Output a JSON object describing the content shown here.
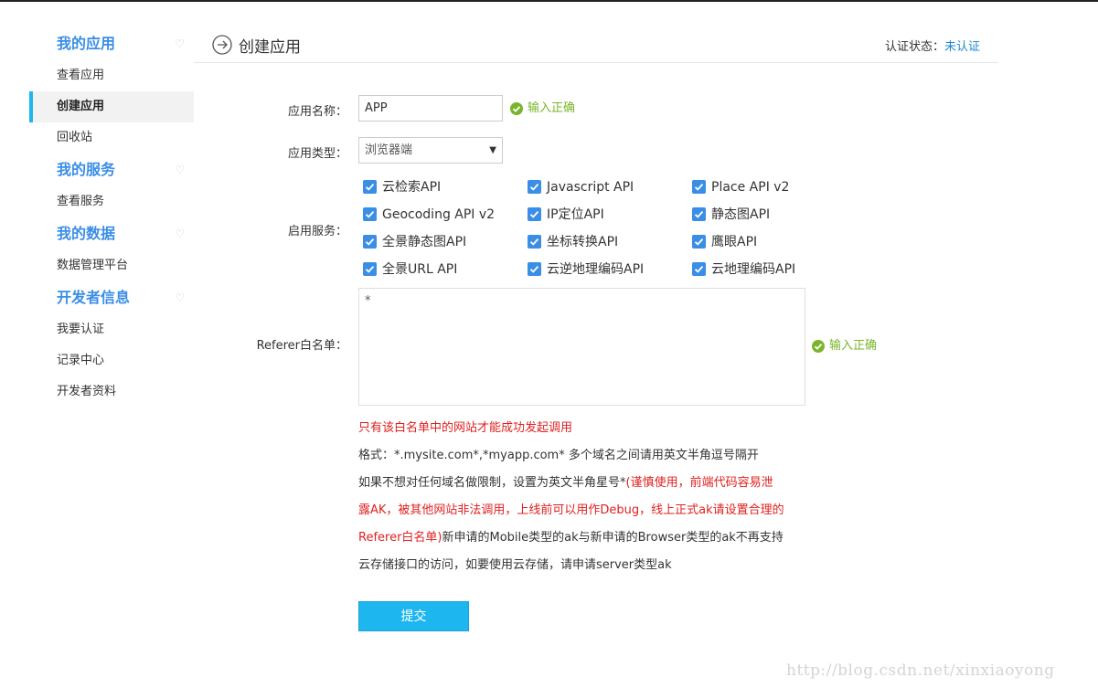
{
  "sidebar": {
    "groups": [
      {
        "title": "我的应用",
        "items": [
          "查看应用",
          "创建应用",
          "回收站"
        ]
      },
      {
        "title": "我的服务",
        "items": [
          "查看服务"
        ]
      },
      {
        "title": "我的数据",
        "items": [
          "数据管理平台"
        ]
      },
      {
        "title": "开发者信息",
        "items": [
          "我要认证",
          "记录中心",
          "开发者资料"
        ]
      }
    ],
    "active_item": "创建应用"
  },
  "header": {
    "title": "创建应用",
    "status_label": "认证状态：",
    "status_value": "未认证"
  },
  "form": {
    "app_name_label": "应用名称：",
    "app_name_value": "APP",
    "app_name_ok": "输入正确",
    "app_type_label": "应用类型：",
    "app_type_value": "浏览器端",
    "services_label": "启用服务：",
    "services": [
      [
        "云检索API",
        "Javascript API",
        "Place API v2"
      ],
      [
        "Geocoding API v2",
        "IP定位API",
        "静态图API"
      ],
      [
        "全景静态图API",
        "坐标转换API",
        "鹰眼API"
      ],
      [
        "全景URL API",
        "云逆地理编码API",
        "云地理编码API"
      ]
    ],
    "referer_label": "Referer白名单：",
    "referer_value": "*",
    "referer_ok": "输入正确",
    "note_red_1": "只有该白名单中的网站才能成功发起调用",
    "note_format": "格式：*.mysite.com*,*myapp.com* 多个域名之间请用英文半角逗号隔开",
    "note_line3_black": "如果不想对任何域名做限制，设置为英文半角星号*",
    "note_line3_red": "(谨慎使用，前端代码容易泄",
    "note_line4_red": "露AK，被其他网站非法调用，上线前可以用作Debug，线上正式ak请设置合理的",
    "note_line5_red": "Referer白名单)",
    "note_line5_black": "新申请的Mobile类型的ak与新申请的Browser类型的ak不再支持",
    "note_line6": "云存储接口的访问，如要使用云存储，请申请server类型ak",
    "submit_label": "提交"
  },
  "watermark": "http://blog.csdn.net/xinxiaoyong",
  "colors": {
    "accent": "#3a8ee6",
    "button": "#1eb6ee",
    "ok": "#79b52a",
    "warning": "#e02020"
  }
}
